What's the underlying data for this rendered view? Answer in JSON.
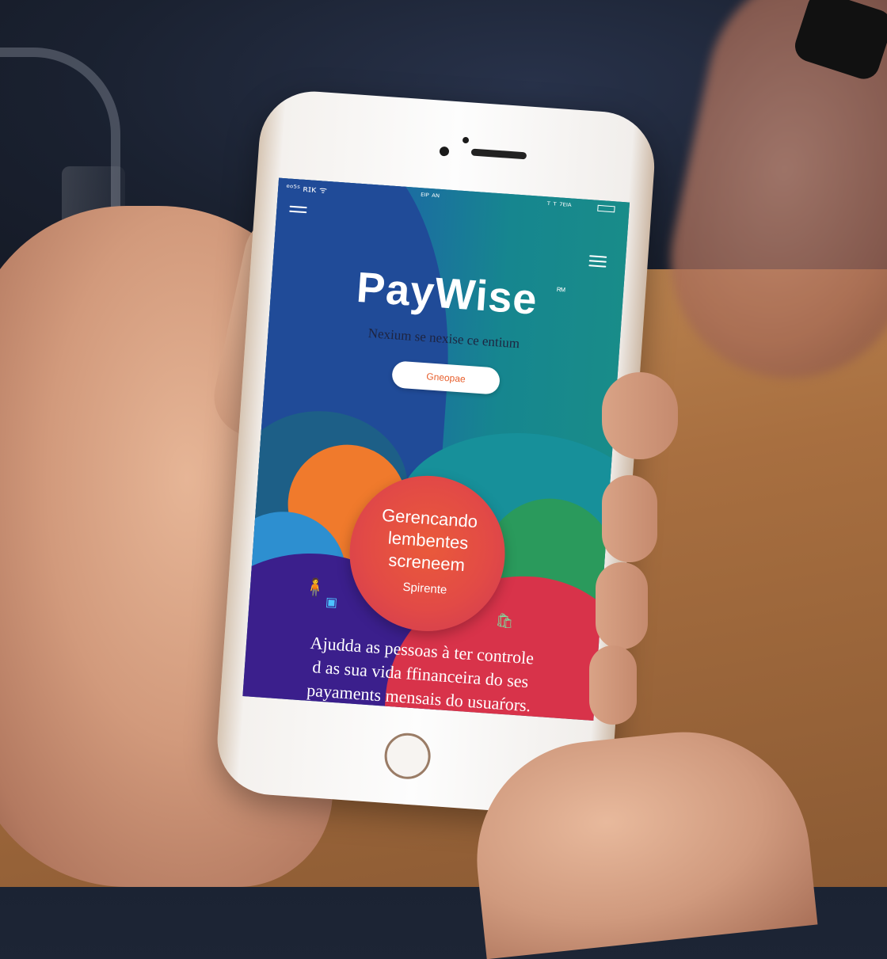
{
  "scene": {
    "description_colors": {
      "table": "#a86f40",
      "background": "#1b2333",
      "phone": "#f4f1ee"
    }
  },
  "phone": {
    "status_bar": {
      "left": "ᵉᵒ⁵ˢ ʀɪᴋ ᯤ",
      "center": "ᴱᴵᴾ ᴬᴺ",
      "right": "ᵀ ᵀ ⁷ᴱᴵᴬ"
    },
    "app": {
      "title": "PayWise",
      "trademark": "ᴿᴹ",
      "tagline": "Nexium se nexise ce entium",
      "cta_label": "Gneopae",
      "circle_card": {
        "lines": [
          "Gerencando",
          "lembentes",
          "screneem"
        ],
        "sub": "Spirente"
      },
      "body_text": [
        "Ajudda as pessoas à ter controle",
        "d as sua vida ffinanceira do ses",
        "payaments mensais do usuaŕors."
      ],
      "colors": {
        "accent": "#e8602e",
        "blue": "#1f4f9a",
        "teal": "#19808f",
        "orange": "#f07a2c",
        "red": "#d8334a",
        "purple": "#3b1f8c",
        "green": "#2a9a5c"
      },
      "icons": [
        "hamburger-menu-icon",
        "menu-icon",
        "person-with-bag-icon",
        "shopping-bag-icon"
      ]
    }
  }
}
